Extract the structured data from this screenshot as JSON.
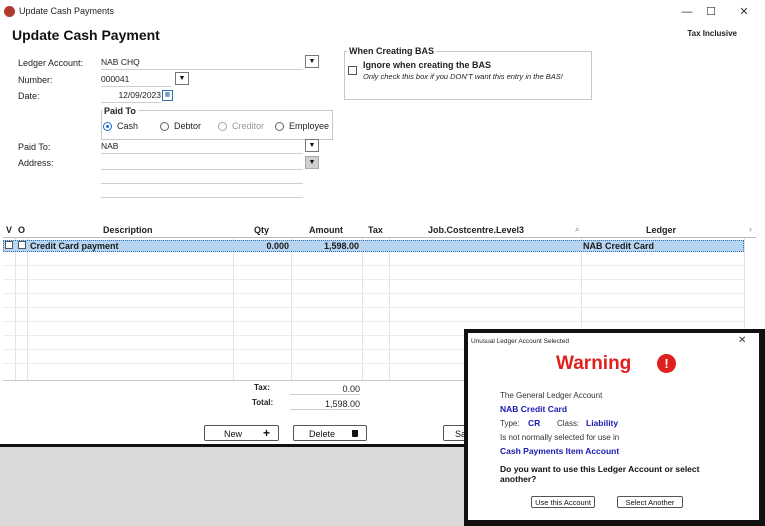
{
  "window": {
    "title": "Update Cash Payments",
    "controls": {
      "minimize": "—",
      "maximize": "☐",
      "close": "✕"
    }
  },
  "heading": "Update Cash Payment",
  "tax_mode": "Tax Inclusive",
  "form": {
    "ledger_account_label": "Ledger Account:",
    "ledger_account_value": "NAB CHQ",
    "number_label": "Number:",
    "number_value": "000041",
    "date_label": "Date:",
    "date_value": "12/09/2023",
    "paid_to_group_title": "Paid To",
    "paid_to_options": [
      "Cash",
      "Debtor",
      "Creditor",
      "Employee"
    ],
    "paid_to_selected": "Cash",
    "paid_to_label": "Paid To:",
    "paid_to_value": "NAB",
    "address_label": "Address:"
  },
  "bas": {
    "group_title": "When Creating BAS",
    "checkbox_label": "Ignore when creating the BAS",
    "hint": "Only check this box if you DON'T want this entry in the BAS!",
    "checked": false
  },
  "grid": {
    "columns": [
      "V",
      "O",
      "Description",
      "Qty",
      "Amount",
      "Tax",
      "Job.Costcentre.Level3",
      "Ledger"
    ],
    "rows": [
      {
        "description": "Credit Card payment",
        "qty": "0.000",
        "amount": "1,598.00",
        "tax": "",
        "job": "",
        "ledger": "NAB Credit Card"
      }
    ]
  },
  "totals": {
    "tax_label": "Tax:",
    "tax_value": "0.00",
    "total_label": "Total:",
    "total_value": "1,598.00"
  },
  "buttons": {
    "new_label": "New",
    "delete_label": "Delete",
    "save_label": "Sa"
  },
  "dialog": {
    "title": "Unusual Ledger Account Selected",
    "warning": "Warning",
    "line1": "The General Ledger Account",
    "account": "NAB Credit Card",
    "type_label": "Type:",
    "type_value": "CR",
    "class_label": "Class:",
    "class_value": "Liability",
    "line2": "Is not normally selected for use in",
    "context": "Cash Payments Item Account",
    "question": "Do you want to use this Ledger Account or select another?",
    "use_button": "Use this Account",
    "select_button": "Select Another"
  },
  "colors": {
    "accent_blue": "#1a1ab0",
    "warning_red": "#e0201e",
    "selected_row": "#b7d5f0"
  }
}
